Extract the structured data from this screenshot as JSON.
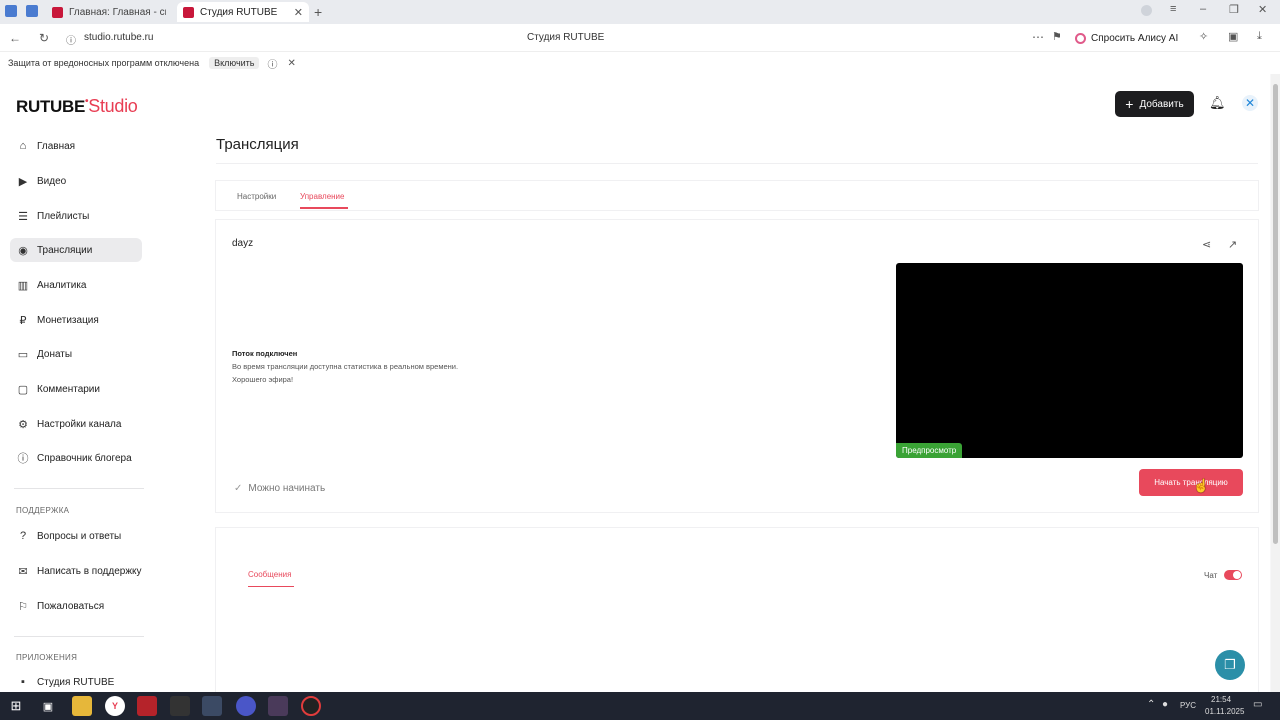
{
  "browser": {
    "tabs": [
      {
        "label": "Главная: Главная - смотр"
      },
      {
        "label": "Студия RUTUBE",
        "active": true
      }
    ],
    "url": "studio.rutube.ru",
    "page_title": "Студия RUTUBE",
    "alice_label": "Спросить Алису AI",
    "protection_text": "Защита от вредоносных программ отключена",
    "protection_button": "Включить"
  },
  "logo": {
    "brand": "RUTUBE",
    "sub": "Studio"
  },
  "header": {
    "add_button": "Добавить"
  },
  "sidebar": {
    "items": [
      {
        "label": "Главная",
        "icon": "home-icon"
      },
      {
        "label": "Видео",
        "icon": "video-icon"
      },
      {
        "label": "Плейлисты",
        "icon": "playlist-icon"
      },
      {
        "label": "Трансляции",
        "icon": "broadcast-icon",
        "active": true
      },
      {
        "label": "Аналитика",
        "icon": "analytics-icon"
      },
      {
        "label": "Монетизация",
        "icon": "money-icon"
      },
      {
        "label": "Донаты",
        "icon": "donate-icon"
      },
      {
        "label": "Комментарии",
        "icon": "comment-icon"
      },
      {
        "label": "Настройки канала",
        "icon": "gear-icon"
      },
      {
        "label": "Справочник блогера",
        "icon": "info-icon"
      }
    ],
    "support_title": "ПОДДЕРЖКА",
    "support_items": [
      {
        "label": "Вопросы и ответы",
        "icon": "help-icon"
      },
      {
        "label": "Написать в поддержку",
        "icon": "mail-icon"
      },
      {
        "label": "Пожаловаться",
        "icon": "flag-icon"
      }
    ],
    "apps_title": "ПРИЛОЖЕНИЯ",
    "apps_items": [
      {
        "label": "Студия RUTUBE",
        "icon": "studio-icon"
      }
    ]
  },
  "page": {
    "title": "Трансляция",
    "tabs": [
      {
        "label": "Настройки"
      },
      {
        "label": "Управление",
        "active": true
      }
    ],
    "stream_name": "dayz",
    "status_title": "Поток подключен",
    "status_line1": "Во время трансляции доступна статистика в реальном времени.",
    "status_line2": "Хорошего эфира!",
    "ready_text": "Можно начинать",
    "preview_badge": "Предпросмотр",
    "start_button": "Начать трансляцию",
    "messages_tab": "Сообщения",
    "chat_label": "Чат"
  },
  "taskbar": {
    "lang": "РУС",
    "time": "21:54",
    "date": "01.11.2025"
  },
  "colors": {
    "accent": "#e8495c",
    "preview": "#3aa335",
    "dark": "#1d1d1f"
  }
}
